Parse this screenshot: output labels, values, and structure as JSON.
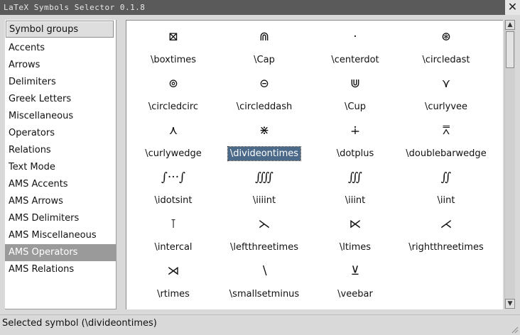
{
  "window": {
    "title": "LaTeX Symbols Selector 0.1.8",
    "close_label": "✕"
  },
  "sidebar": {
    "header": "Symbol groups",
    "selected_index": 14,
    "items": [
      "Accents",
      "Arrows",
      "Delimiters",
      "Greek Letters",
      "Miscellaneous",
      "Operators",
      "Relations",
      "Text Mode",
      "AMS Accents",
      "AMS Arrows",
      "AMS Delimiters",
      "AMS Miscellaneous",
      "AMS Operators",
      "AMS Relations"
    ]
  },
  "symbols": [
    {
      "glyph": "⊠",
      "name": "\\boxtimes"
    },
    {
      "glyph": "⋒",
      "name": "\\Cap"
    },
    {
      "glyph": "·",
      "name": "\\centerdot"
    },
    {
      "glyph": "⊛",
      "name": "\\circledast"
    },
    {
      "glyph": "⊚",
      "name": "\\circledcirc"
    },
    {
      "glyph": "⊝",
      "name": "\\circleddash"
    },
    {
      "glyph": "⋓",
      "name": "\\Cup"
    },
    {
      "glyph": "⋎",
      "name": "\\curlyvee"
    },
    {
      "glyph": "⋏",
      "name": "\\curlywedge"
    },
    {
      "glyph": "⋇",
      "name": "\\divideontimes"
    },
    {
      "glyph": "∔",
      "name": "\\dotplus"
    },
    {
      "glyph": "⩞",
      "name": "\\doublebarwedge"
    },
    {
      "glyph": "∫···∫",
      "name": "\\idotsint"
    },
    {
      "glyph": "⨌",
      "name": "\\iiiint"
    },
    {
      "glyph": "∭",
      "name": "\\iiint"
    },
    {
      "glyph": "∬",
      "name": "\\iint"
    },
    {
      "glyph": "⊺",
      "name": "\\intercal"
    },
    {
      "glyph": "⋋",
      "name": "\\leftthreetimes"
    },
    {
      "glyph": "⋉",
      "name": "\\ltimes"
    },
    {
      "glyph": "⋌",
      "name": "\\rightthreetimes"
    },
    {
      "glyph": "⋊",
      "name": "\\rtimes"
    },
    {
      "glyph": "∖",
      "name": "\\smallsetminus"
    },
    {
      "glyph": "⊻",
      "name": "\\veebar"
    }
  ],
  "selected_symbol": "\\divideontimes",
  "status": {
    "text": "Selected symbol (\\divideontimes)"
  },
  "colors": {
    "selection": "#4b6a8a",
    "sidebar_selection": "#9a9a9a",
    "titlebar": "#5a5a5a"
  },
  "icons": {
    "close": "close-icon",
    "scroll_up": "arrow-up-icon",
    "scroll_down": "arrow-down-icon",
    "resize": "resize-grip-icon"
  }
}
